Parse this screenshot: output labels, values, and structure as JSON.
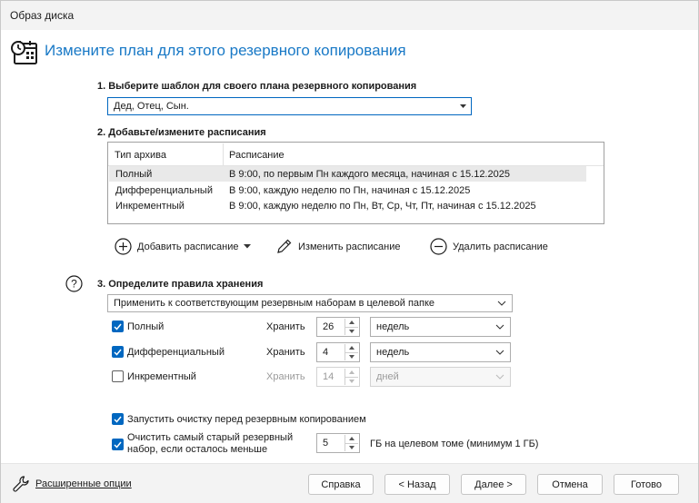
{
  "window": {
    "title": "Образ диска"
  },
  "header": {
    "title": "Измените план для этого резервного копирования",
    "icon": "calendar-clock-icon"
  },
  "step1": {
    "label": "1. Выберите шаблон для своего плана резервного копирования",
    "template_value": "Дед, Отец, Сын."
  },
  "step2": {
    "label": "2. Добавьте/измените расписания",
    "columns": [
      "Тип архива",
      "Расписание"
    ],
    "rows": [
      {
        "type": "Полный",
        "schedule": "В 9:00, по первым Пн каждого месяца, начиная с 15.12.2025"
      },
      {
        "type": "Дифференциальный",
        "schedule": "В 9:00, каждую неделю по Пн, начиная с 15.12.2025"
      },
      {
        "type": "Инкрементный",
        "schedule": "В 9:00, каждую неделю по Пн, Вт, Ср, Чт, Пт, начиная с 15.12.2025"
      }
    ],
    "actions": {
      "add": "Добавить расписание",
      "edit": "Изменить расписание",
      "delete": "Удалить расписание"
    }
  },
  "step3": {
    "label": "3. Определите правила хранения",
    "apply_value": "Применить к соответствующим резервным наборам в целевой папке",
    "rules": [
      {
        "label": "Полный",
        "checked": true,
        "keep_label": "Хранить",
        "count": "26",
        "unit": "недель",
        "enabled": true
      },
      {
        "label": "Дифференциальный",
        "checked": true,
        "keep_label": "Хранить",
        "count": "4",
        "unit": "недель",
        "enabled": true
      },
      {
        "label": "Инкрементный",
        "checked": false,
        "keep_label": "Хранить",
        "count": "14",
        "unit": "дней",
        "enabled": false
      }
    ],
    "cleanup_label": "Запустить очистку перед резервным копированием",
    "purge_label_line1": "Очистить самый старый резервный",
    "purge_label_line2": "набор, если осталось меньше",
    "purge_value": "5",
    "purge_suffix": "ГБ на целевом томе (минимум 1 ГБ)"
  },
  "footer": {
    "advanced": "Расширенные опции",
    "help": "Справка",
    "back": "< Назад",
    "next": "Далее >",
    "cancel": "Отмена",
    "finish": "Готово"
  }
}
